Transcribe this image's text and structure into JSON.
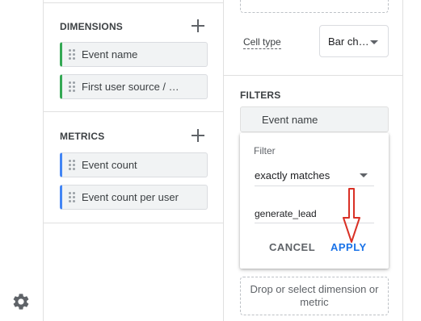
{
  "icons": {
    "settings": "gear-icon",
    "add": "plus-icon",
    "drag": "drag-handle-icon",
    "dropdown": "caret-down-icon",
    "annotation": "red-down-arrow"
  },
  "colors": {
    "accent": "#1a73e8",
    "dimension": "#34a853",
    "metric": "#4285f4",
    "annotation": "#d93025"
  },
  "dimensions": {
    "title": "DIMENSIONS",
    "items": [
      {
        "label": "Event name"
      },
      {
        "label": "First user source / …"
      }
    ]
  },
  "metrics": {
    "title": "METRICS",
    "items": [
      {
        "label": "Event count"
      },
      {
        "label": "Event count per user"
      }
    ]
  },
  "settings": {
    "cell_type_label": "Cell type",
    "cell_type_value": "Bar ch…"
  },
  "filters": {
    "title": "FILTERS",
    "chip_label": "Event name",
    "card": {
      "label": "Filter",
      "match_type": "exactly matches",
      "value": "generate_lead",
      "cancel": "CANCEL",
      "apply": "APPLY"
    },
    "drop_zone": "Drop or select dimension or metric"
  }
}
